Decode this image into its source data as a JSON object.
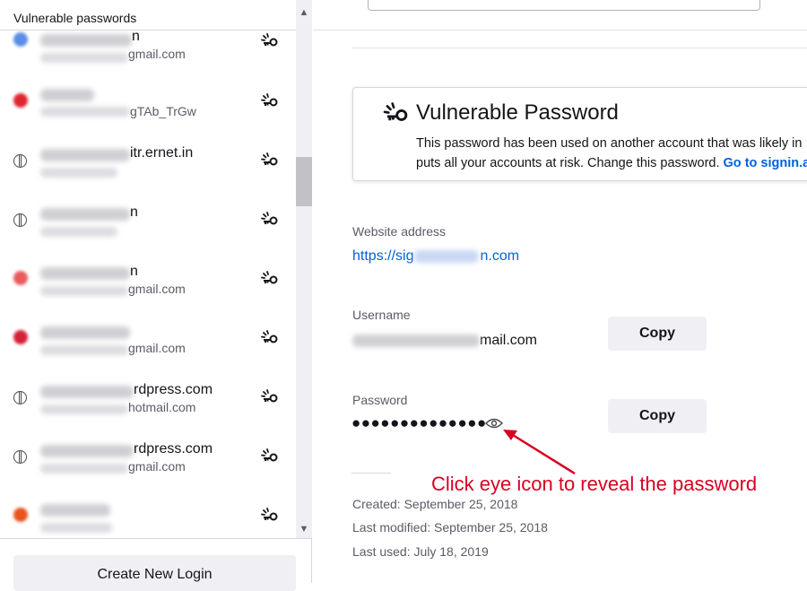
{
  "sidebar": {
    "header": "Vulnerable passwords",
    "items": [
      {
        "line1_visible": "n",
        "line2_visible": "gmail.com",
        "favicon_color": "#5a8ee6"
      },
      {
        "line1_visible": "",
        "line2_visible": "gTAb_TrGw",
        "favicon_color": "#e0252f"
      },
      {
        "line1_visible": "itr.ernet.in",
        "line2_visible": "",
        "favicon_color": "globe"
      },
      {
        "line1_visible": "n",
        "line2_visible": "",
        "favicon_color": "globe"
      },
      {
        "line1_visible": "n",
        "line2_visible": "gmail.com",
        "favicon_color": "#e85b5b"
      },
      {
        "line1_visible": "",
        "line2_visible": "gmail.com",
        "favicon_color": "#d4213a"
      },
      {
        "line1_visible": "rdpress.com",
        "line2_visible": "hotmail.com",
        "favicon_color": "globe"
      },
      {
        "line1_visible": "rdpress.com",
        "line2_visible": "gmail.com",
        "favicon_color": "globe"
      },
      {
        "line1_visible": "",
        "line2_visible": "",
        "favicon_color": "#e8541e"
      }
    ],
    "alert_icon": "vulnerable-key-icon",
    "create_button": "Create New Login"
  },
  "main": {
    "card": {
      "title": "Vulnerable Password",
      "text_line1": "This password has been used on another account that was likely in",
      "text_line2": "puts all your accounts at risk. Change this password.",
      "link": "Go to signin.a"
    },
    "website_label": "Website address",
    "website_url_start": "https://sig",
    "website_url_end": "n.com",
    "username_label": "Username",
    "username_visible": "mail.com",
    "copy_label": "Copy",
    "password_label": "Password",
    "password_mask": "●●●●●●●●●●●●●●",
    "annotation": "Click eye icon to reveal the password",
    "created": "Created: September 25, 2018",
    "modified": "Last modified: September 25, 2018",
    "last_used": "Last used: July 18, 2019"
  },
  "colors": {
    "link": "#0060df",
    "annotation": "#d70022",
    "button": "#f0f0f4"
  }
}
